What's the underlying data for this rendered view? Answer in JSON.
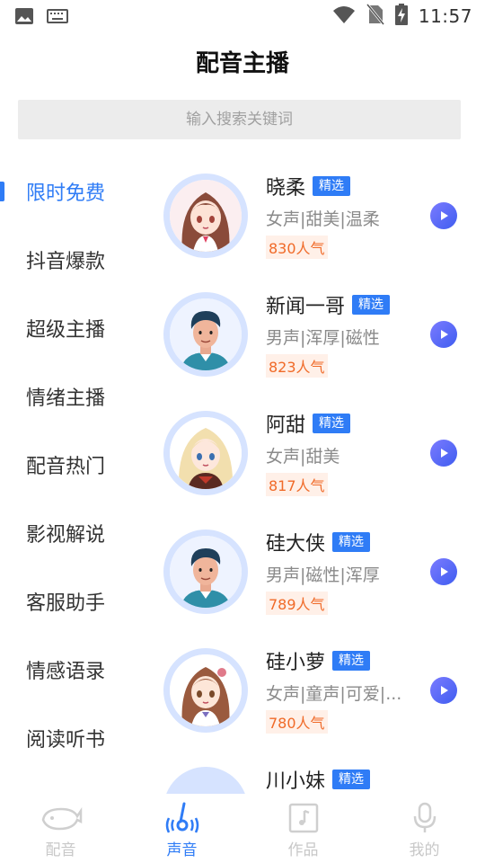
{
  "status_bar": {
    "time": "11:57",
    "icons": [
      "image-icon",
      "keyboard-icon",
      "wifi-icon",
      "no-sim-icon",
      "battery-charging-icon"
    ]
  },
  "header": {
    "title": "配音主播"
  },
  "search": {
    "placeholder": "输入搜索关键词"
  },
  "sidebar": {
    "items": [
      {
        "label": "限时免费",
        "active": true
      },
      {
        "label": "抖音爆款"
      },
      {
        "label": "超级主播"
      },
      {
        "label": "情绪主播"
      },
      {
        "label": "配音热门"
      },
      {
        "label": "影视解说"
      },
      {
        "label": "客服助手"
      },
      {
        "label": "情感语录"
      },
      {
        "label": "阅读听书"
      }
    ]
  },
  "anchors": [
    {
      "name": "晓柔",
      "tag": "精选",
      "desc": "女声|甜美|温柔",
      "popularity": "830人气",
      "avatar": "anime-girl-brown-hair-avatar"
    },
    {
      "name": "新闻一哥",
      "tag": "精选",
      "desc": "男声|浑厚|磁性",
      "popularity": "823人气",
      "avatar": "cartoon-man-avatar"
    },
    {
      "name": "阿甜",
      "tag": "精选",
      "desc": "女声|甜美",
      "popularity": "817人气",
      "avatar": "anime-girl-blonde-avatar"
    },
    {
      "name": "硅大侠",
      "tag": "精选",
      "desc": "男声|磁性|浑厚",
      "popularity": "789人气",
      "avatar": "cartoon-man-avatar"
    },
    {
      "name": "硅小萝",
      "tag": "精选",
      "desc": "女声|童声|可爱|...",
      "popularity": "780人气",
      "avatar": "anime-girl-child-avatar"
    },
    {
      "name": "川小妹",
      "tag": "精选",
      "desc": "",
      "popularity": "",
      "avatar": ""
    }
  ],
  "tabbar": {
    "tabs": [
      {
        "label": "配音",
        "icon": "whale-icon"
      },
      {
        "label": "声音",
        "icon": "sound-wave-icon",
        "active": true
      },
      {
        "label": "作品",
        "icon": "document-music-icon"
      },
      {
        "label": "我的",
        "icon": "microphone-icon"
      }
    ]
  },
  "colors": {
    "accent": "#2f7cf6",
    "popularity_text": "#f06a28",
    "popularity_bg": "#fff0e8",
    "avatar_ring": "#d6e3ff"
  }
}
